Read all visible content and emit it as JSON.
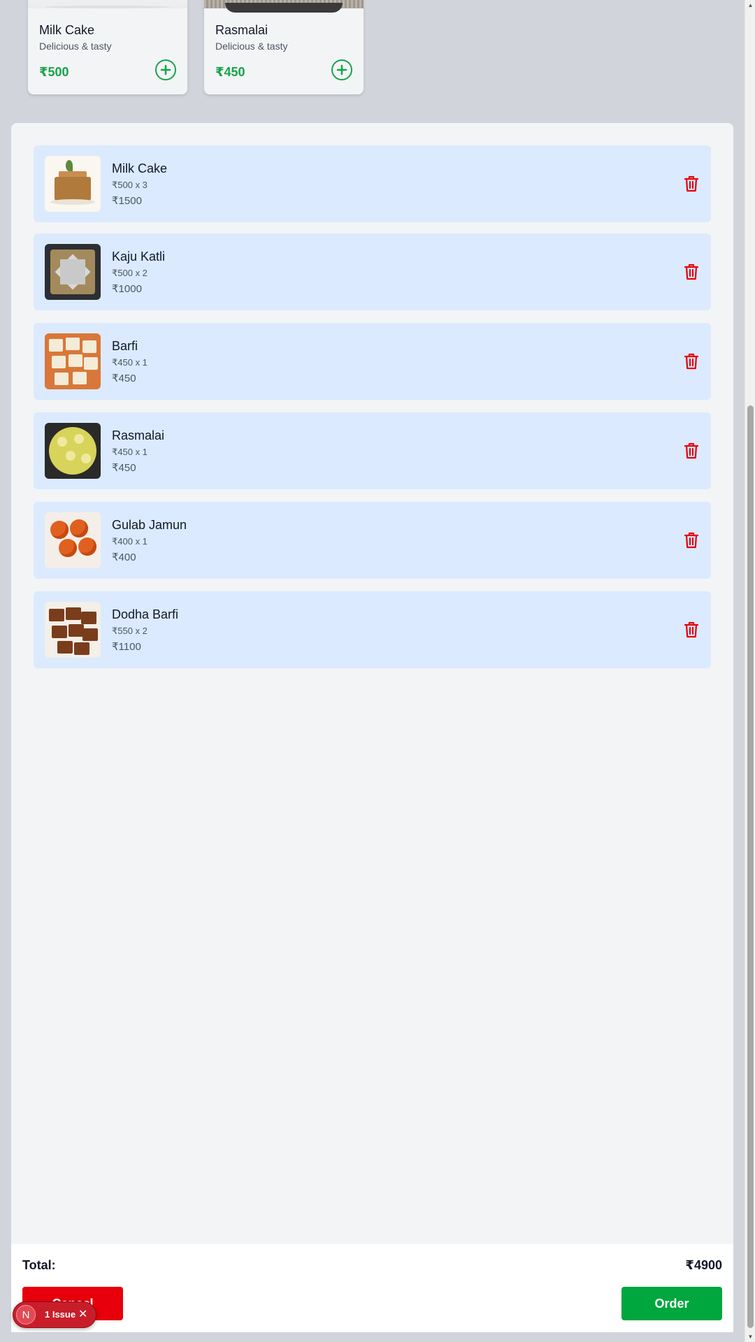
{
  "products": [
    {
      "name": "Milk Cake",
      "description": "Delicious & tasty",
      "price": "₹500",
      "add_icon": "plus-circle-icon"
    },
    {
      "name": "Rasmalai",
      "description": "Delicious & tasty",
      "price": "₹450",
      "add_icon": "plus-circle-icon"
    }
  ],
  "cart": {
    "items": [
      {
        "name": "Milk Cake",
        "qty_line": "₹500 x 3",
        "line_total": "₹1500"
      },
      {
        "name": "Kaju Katli",
        "qty_line": "₹500 x 2",
        "line_total": "₹1000"
      },
      {
        "name": "Barfi",
        "qty_line": "₹450 x 1",
        "line_total": "₹450"
      },
      {
        "name": "Rasmalai",
        "qty_line": "₹450 x 1",
        "line_total": "₹450"
      },
      {
        "name": "Gulab Jamun",
        "qty_line": "₹400 x 1",
        "line_total": "₹400"
      },
      {
        "name": "Dodha Barfi",
        "qty_line": "₹550 x 2",
        "line_total": "₹1100"
      }
    ],
    "delete_icon": "trash-icon"
  },
  "footer": {
    "total_label": "Total:",
    "total_value": "₹4900",
    "cancel_label": "Cancel",
    "order_label": "Order"
  },
  "dev_overlay": {
    "logo_letter": "N",
    "issues_label": "1 Issue",
    "dismiss_glyph": "✕"
  },
  "colors": {
    "page_bg": "#d1d5db",
    "accent_green": "#16a34a",
    "order_green": "#00a63e",
    "cancel_red": "#e7000b",
    "cart_item_bg": "#dbeafe",
    "trash_red": "#e7000b"
  }
}
